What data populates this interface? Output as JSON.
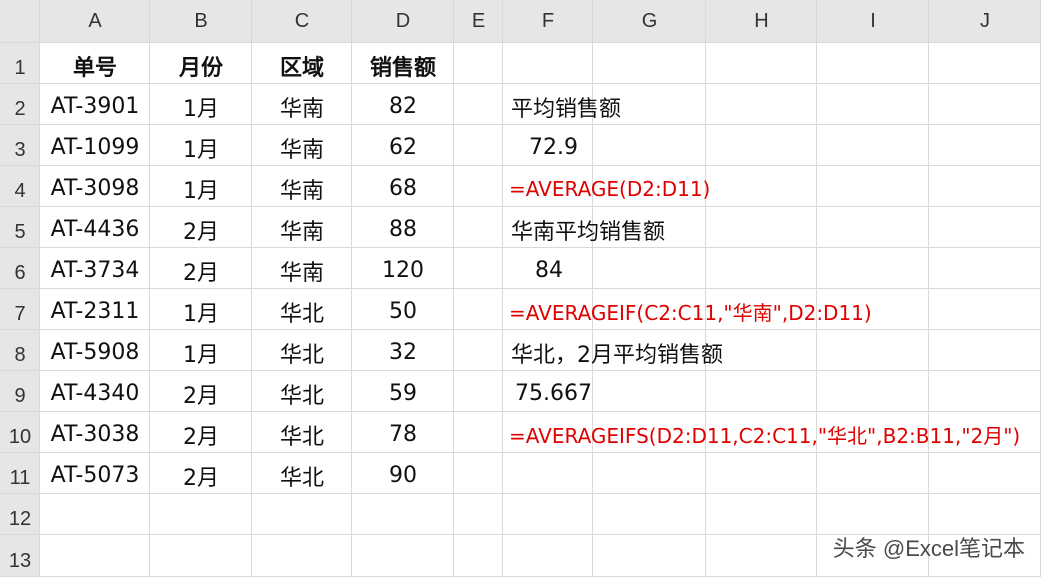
{
  "columns": [
    "A",
    "B",
    "C",
    "D",
    "E",
    "F",
    "G",
    "H",
    "I",
    "J"
  ],
  "rows": [
    "1",
    "2",
    "3",
    "4",
    "5",
    "6",
    "7",
    "8",
    "9",
    "10",
    "11",
    "12",
    "13"
  ],
  "table": {
    "headers": [
      "单号",
      "月份",
      "区域",
      "销售额"
    ],
    "records": [
      [
        "AT-3901",
        "1月",
        "华南",
        "82"
      ],
      [
        "AT-1099",
        "1月",
        "华南",
        "62"
      ],
      [
        "AT-3098",
        "1月",
        "华南",
        "68"
      ],
      [
        "AT-4436",
        "2月",
        "华南",
        "88"
      ],
      [
        "AT-3734",
        "2月",
        "华南",
        "120"
      ],
      [
        "AT-2311",
        "1月",
        "华北",
        "50"
      ],
      [
        "AT-5908",
        "1月",
        "华北",
        "32"
      ],
      [
        "AT-4340",
        "2月",
        "华北",
        "59"
      ],
      [
        "AT-3038",
        "2月",
        "华北",
        "78"
      ],
      [
        "AT-5073",
        "2月",
        "华北",
        "90"
      ]
    ]
  },
  "notes": {
    "avg_label": "平均销售额",
    "avg_value": "72.9",
    "avg_formula": "=AVERAGE(D2:D11)",
    "south_label": "华南平均销售额",
    "south_value": "84",
    "south_formula": "=AVERAGEIF(C2:C11,\"华南\",D2:D11)",
    "north_label": "华北，2月平均销售额",
    "north_value": "75.667",
    "north_formula": "=AVERAGEIFS(D2:D11,C2:C11,\"华北\",B2:B11,\"2月\")"
  },
  "watermark": "头条 @Excel笔记本",
  "colors": {
    "formula": "#e00000",
    "grid": "#d9d9d9",
    "header_bg": "#e6e6e6"
  }
}
